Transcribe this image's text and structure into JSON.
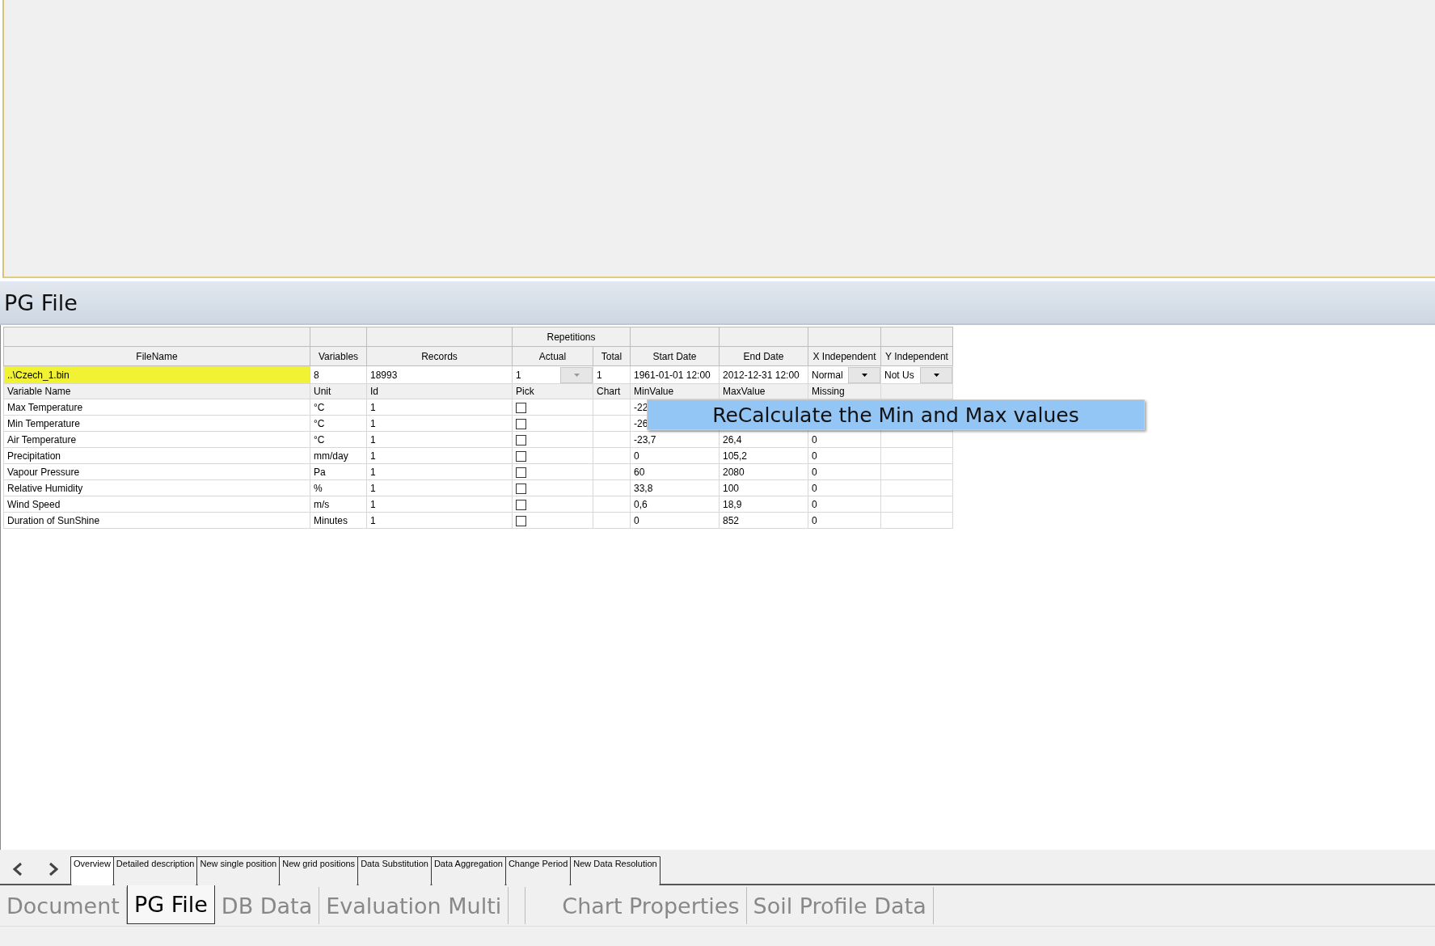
{
  "panel_title": "PG File",
  "table": {
    "group_header": "Repetitions",
    "columns": [
      "FileName",
      "Variables",
      "Records",
      "Actual",
      "Total",
      "Start Date",
      "End Date",
      "X Independent",
      "Y Independent"
    ],
    "file_row": {
      "file_name": "..\\Czech_1.bin",
      "selected": true,
      "variables": "8",
      "records": "18993",
      "actual": "1",
      "total": "1",
      "start_date": "1961-01-01 12:00",
      "end_date": "2012-12-31 12:00",
      "x_independent": "Normal",
      "y_independent": "Not Us"
    },
    "variable_columns": [
      "Variable Name",
      "Unit",
      "Id",
      "Pick",
      "Chart",
      "MinValue",
      "MaxValue",
      "Missing"
    ],
    "rows": [
      {
        "name": "Max Temperature",
        "unit": "°C",
        "id": "1",
        "pick": false,
        "min": "-22"
      },
      {
        "name": "Min Temperature",
        "unit": "°C",
        "id": "1",
        "pick": false,
        "min": "-26"
      },
      {
        "name": "Air Temperature",
        "unit": "°C",
        "id": "1",
        "pick": false,
        "min": "-23,7",
        "max": "26,4",
        "missing": "0"
      },
      {
        "name": "Precipitation",
        "unit": "mm/day",
        "id": "1",
        "pick": false,
        "min": "0",
        "max": "105,2",
        "missing": "0"
      },
      {
        "name": "Vapour Pressure",
        "unit": "Pa",
        "id": "1",
        "pick": false,
        "min": "60",
        "max": "2080",
        "missing": "0"
      },
      {
        "name": "Relative Humidity",
        "unit": "%",
        "id": "1",
        "pick": false,
        "min": "33,8",
        "max": "100",
        "missing": "0"
      },
      {
        "name": "Wind Speed",
        "unit": "m/s",
        "id": "1",
        "pick": false,
        "min": "0,6",
        "max": "18,9",
        "missing": "0"
      },
      {
        "name": "Duration of SunShine",
        "unit": "Minutes",
        "id": "1",
        "pick": false,
        "min": "0",
        "max": "852",
        "missing": "0"
      }
    ]
  },
  "tooltip": "ReCalculate the Min and Max values",
  "sub_tabs": [
    {
      "label": "Overview",
      "selected": true
    },
    {
      "label": "Detailed description",
      "selected": false
    },
    {
      "label": "New single position",
      "selected": false
    },
    {
      "label": "New grid positions",
      "selected": false
    },
    {
      "label": "Data Substitution",
      "selected": false
    },
    {
      "label": "Data Aggregation",
      "selected": false
    },
    {
      "label": "Change Period",
      "selected": false
    },
    {
      "label": "New Data Resolution",
      "selected": false
    }
  ],
  "main_tabs": [
    {
      "label": "Document",
      "selected": false
    },
    {
      "label": "PG File",
      "selected": true
    },
    {
      "label": "DB Data",
      "selected": false
    },
    {
      "label": "Evaluation Multi",
      "selected": false
    },
    {
      "label": "Chart Properties",
      "selected": false
    },
    {
      "label": "Soil Profile Data",
      "selected": false
    }
  ]
}
